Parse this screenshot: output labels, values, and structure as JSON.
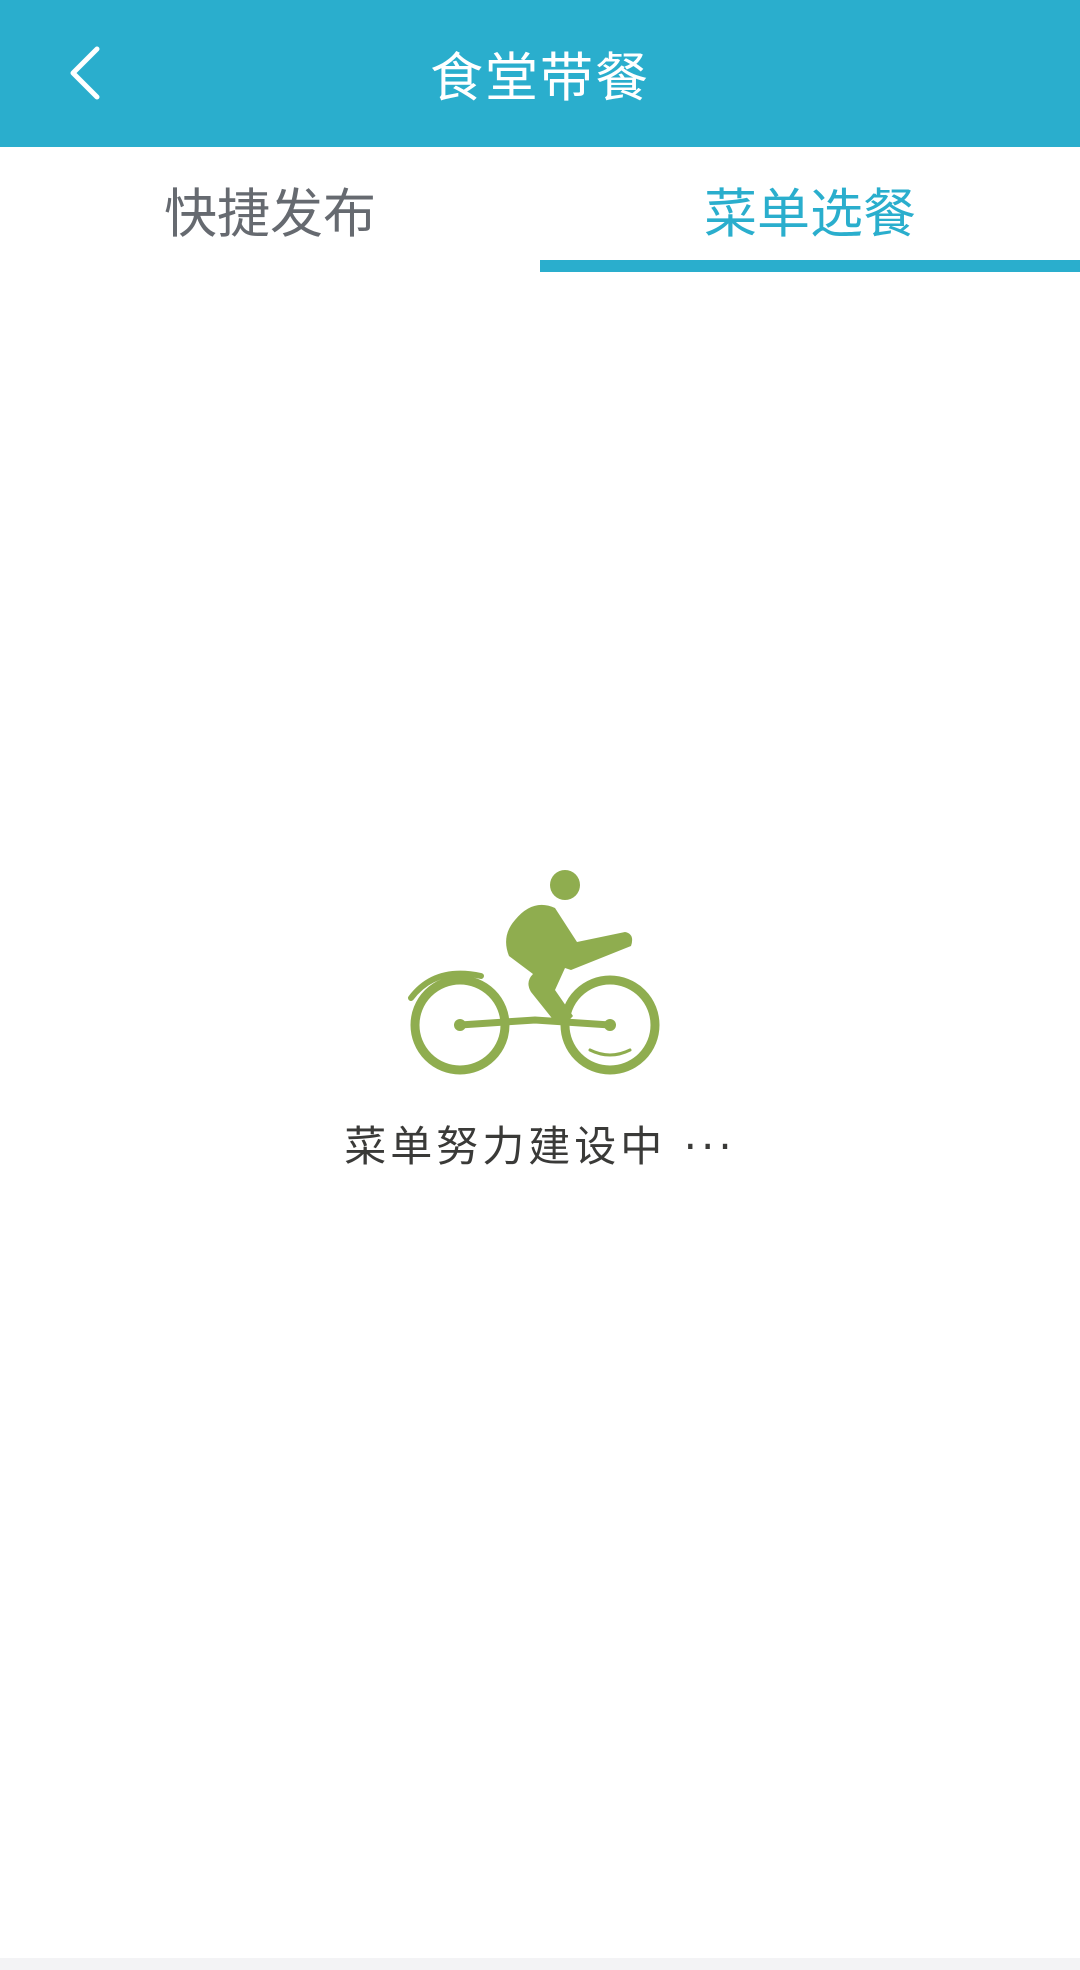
{
  "header": {
    "title": "食堂带餐",
    "back_icon": "chevron-left-icon",
    "background_color": "#2aaecd"
  },
  "tabs": [
    {
      "label": "快捷发布",
      "active": false
    },
    {
      "label": "菜单选餐",
      "active": true
    }
  ],
  "accent_color": "#2aaecd",
  "empty_state": {
    "icon": "cyclist-icon",
    "icon_color": "#8fad4f",
    "message": "菜单努力建设中 ···"
  }
}
